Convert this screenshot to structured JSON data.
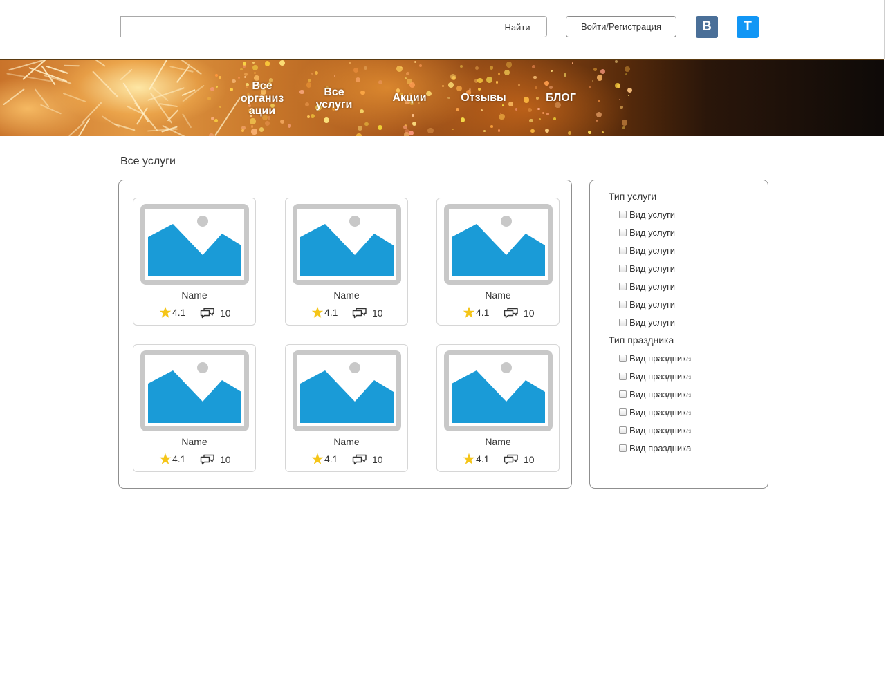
{
  "header": {
    "search": {
      "value": "",
      "placeholder": "",
      "button_label": "Найти"
    },
    "login_label": "Войти/Регистрация",
    "social": [
      {
        "name": "vk",
        "label": "В",
        "color": "#4a6f98"
      },
      {
        "name": "telegram",
        "label": "Т",
        "color": "#1196f5"
      }
    ]
  },
  "nav": {
    "items": [
      {
        "label": "Все организ ации"
      },
      {
        "label": "Все услуги"
      },
      {
        "label": "Акции"
      },
      {
        "label": "Отзывы"
      },
      {
        "label": "БЛОГ"
      }
    ]
  },
  "main": {
    "title": "Все услуги",
    "cards": [
      {
        "name": "Name",
        "rating": "4.1",
        "comments": "10",
        "icon": "image-placeholder-icon"
      },
      {
        "name": "Name",
        "rating": "4.1",
        "comments": "10",
        "icon": "image-placeholder-icon"
      },
      {
        "name": "Name",
        "rating": "4.1",
        "comments": "10",
        "icon": "image-placeholder-icon"
      },
      {
        "name": "Name",
        "rating": "4.1",
        "comments": "10",
        "icon": "image-placeholder-icon"
      },
      {
        "name": "Name",
        "rating": "4.1",
        "comments": "10",
        "icon": "image-placeholder-icon"
      },
      {
        "name": "Name",
        "rating": "4.1",
        "comments": "10",
        "icon": "image-placeholder-icon"
      }
    ]
  },
  "filters": {
    "service_type": {
      "title": "Тип услуги",
      "options": [
        "Вид услуги",
        "Вид услуги",
        "Вид услуги",
        "Вид услуги",
        "Вид услуги",
        "Вид услуги",
        "Вид услуги"
      ]
    },
    "holiday_type": {
      "title": "Тип праздника",
      "options": [
        "Вид праздника",
        "Вид праздника",
        "Вид праздника",
        "Вид праздника",
        "Вид праздника",
        "Вид праздника"
      ]
    }
  },
  "colors": {
    "placeholder_blue": "#1a9bd7",
    "placeholder_gray": "#c8c8c8",
    "star": "#f5c518"
  }
}
